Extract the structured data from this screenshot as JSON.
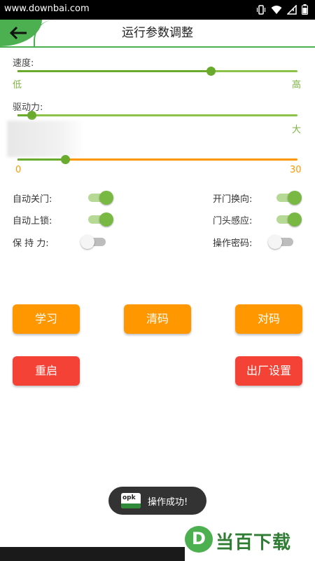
{
  "status_bar": {
    "watermark": "www.downbai.com",
    "icons": [
      "vibrate-icon",
      "wifi-icon",
      "signal-icon",
      "battery-icon"
    ]
  },
  "header": {
    "title": "运行参数调整",
    "back_icon": "arrow-left-icon"
  },
  "speed": {
    "label": "速度:",
    "value_fraction": 0.69,
    "min_label": "低",
    "max_label": "高"
  },
  "drive_force": {
    "label": "驱动力:",
    "value_fraction": 0.05,
    "max_label": "大"
  },
  "range_slider": {
    "value_fraction": 0.17,
    "min_label": "0",
    "max_label": "30"
  },
  "toggles": [
    {
      "label": "自动关门:",
      "on": true
    },
    {
      "label": "开门换向:",
      "on": true
    },
    {
      "label": "自动上锁:",
      "on": true
    },
    {
      "label": "门头感应:",
      "on": true
    },
    {
      "label": "保 持 力:",
      "on": false
    },
    {
      "label": "操作密码:",
      "on": false
    }
  ],
  "buttons": {
    "learn": "学习",
    "clear_code": "清码",
    "pair_code": "对码",
    "restart": "重启",
    "factory_reset": "出厂设置"
  },
  "toast": {
    "logo_text": "opk",
    "message": "操作成功!"
  },
  "brand": {
    "letter": "D",
    "text": "当百下载"
  },
  "colors": {
    "accent_green": "#4caf50",
    "orange": "#ff9800",
    "red": "#f44336"
  }
}
